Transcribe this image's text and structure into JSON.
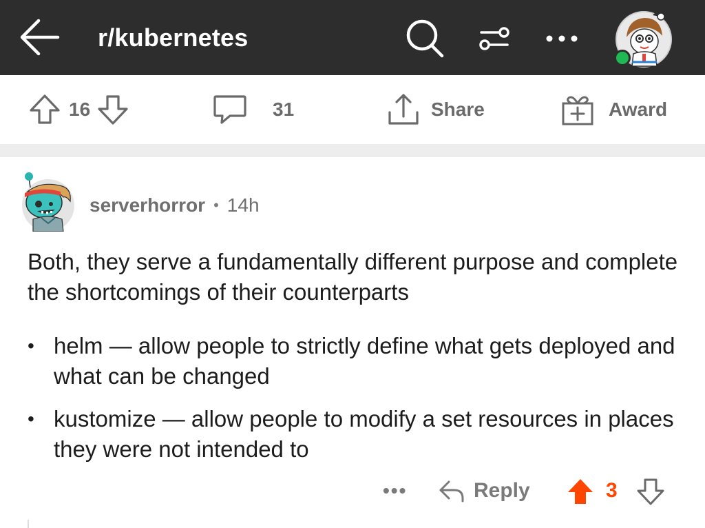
{
  "header": {
    "subreddit": "r/kubernetes",
    "icons": [
      "back-arrow-icon",
      "search-icon",
      "filter-sliders-icon",
      "more-horizontal-icon",
      "user-avatar"
    ],
    "bg_color": "#2d2d2d",
    "online_status_color": "#1eb854"
  },
  "post_actions": {
    "upvote_icon": "arrow-up-outline-icon",
    "score": "16",
    "downvote_icon": "arrow-down-outline-icon",
    "comments_icon": "speech-bubble-icon",
    "comments_count": "31",
    "share_icon": "share-upload-icon",
    "share_label": "Share",
    "award_icon": "gift-box-icon",
    "award_label": "Award"
  },
  "comment": {
    "username": "serverhorror",
    "separator": "•",
    "time": "14h",
    "body": "Both, they serve a fundamentally different purpose and complete the shortcomings of their counterparts",
    "list": [
      "helm — allow people to strictly define what gets deployed and what can be changed",
      "kustomize — allow people to modify a set resources in places they were not intended to"
    ],
    "bullet": "•",
    "more_label": "•••",
    "reply_label": "Reply",
    "score": "3",
    "accent_color": "#ff4500"
  }
}
